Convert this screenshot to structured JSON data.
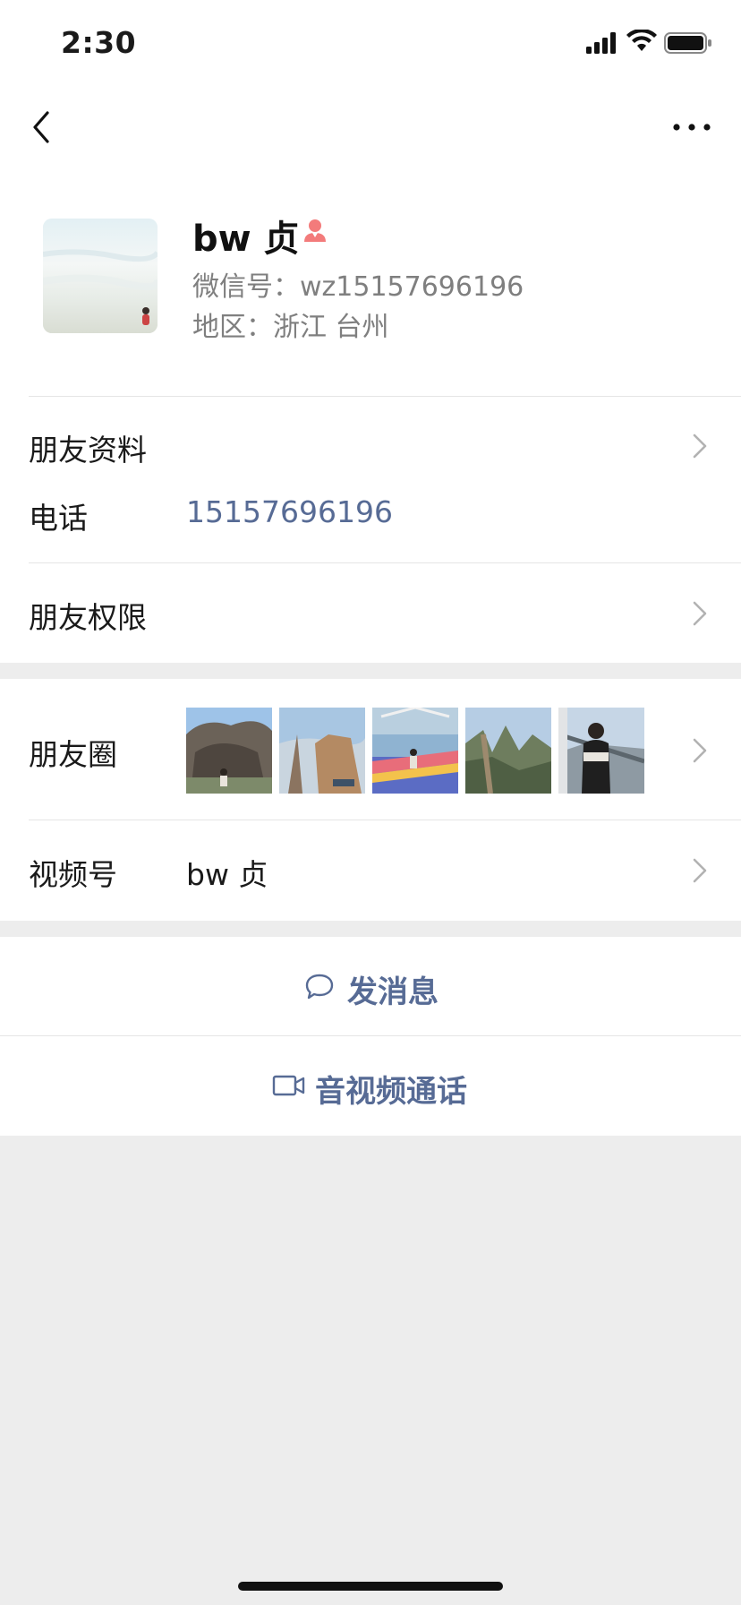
{
  "status_bar": {
    "time": "2:30"
  },
  "profile": {
    "name": "bw 贞",
    "wechat_id": "微信号：wz15157696196",
    "region": "地区：浙江 台州"
  },
  "rows": {
    "friend_info": "朋友资料",
    "phone_label": "电话",
    "phone_value": "15157696196",
    "friend_permissions": "朋友权限",
    "moments": "朋友圈",
    "channels_label": "视频号",
    "channels_value": "bw 贞"
  },
  "actions": {
    "message": "发消息",
    "call": "音视频通话"
  },
  "colors": {
    "link": "#576b95",
    "background": "#ededed",
    "gender_female": "#f37b7b"
  },
  "icons": [
    "back-icon",
    "more-icon",
    "female-icon",
    "chevron-right-icon",
    "chat-bubble-icon",
    "video-camera-icon"
  ]
}
